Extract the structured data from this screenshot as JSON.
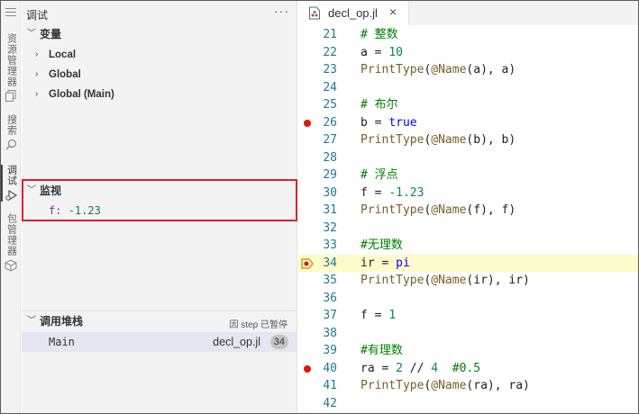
{
  "activity_bar": {
    "explorer_label": "资源管理器",
    "search_label": "搜索",
    "debug_label": "调试",
    "packages_label": "包管理器"
  },
  "sidebar": {
    "title": "调试",
    "more": "···",
    "variables": {
      "header": "变量",
      "scopes": [
        "Local",
        "Global",
        "Global (Main)"
      ]
    },
    "watch": {
      "header": "监视",
      "expression_name": "f",
      "expression_value": "-1.23"
    },
    "call_stack": {
      "header": "调用堆栈",
      "status": "因 step 已暂停",
      "frame": {
        "function": "Main",
        "file": "decl_op.jl",
        "line": "34"
      }
    }
  },
  "editor": {
    "tab": {
      "label": "decl_op.jl",
      "close": "×",
      "icon": "julia-file-icon"
    },
    "current_line": 34,
    "breakpoint_lines": [
      26,
      34,
      40
    ],
    "lines": [
      {
        "n": "21",
        "text": "# 整数"
      },
      {
        "n": "22",
        "text": "a = 10"
      },
      {
        "n": "23",
        "text": "PrintType(@Name(a), a)"
      },
      {
        "n": "24",
        "text": ""
      },
      {
        "n": "25",
        "text": "# 布尔"
      },
      {
        "n": "26",
        "text": "b = true"
      },
      {
        "n": "27",
        "text": "PrintType(@Name(b), b)"
      },
      {
        "n": "28",
        "text": ""
      },
      {
        "n": "29",
        "text": "# 浮点"
      },
      {
        "n": "30",
        "text": "f = -1.23"
      },
      {
        "n": "31",
        "text": "PrintType(@Name(f), f)"
      },
      {
        "n": "32",
        "text": ""
      },
      {
        "n": "33",
        "text": "#无理数"
      },
      {
        "n": "34",
        "text": "ir = pi"
      },
      {
        "n": "35",
        "text": "PrintType(@Name(ir), ir)"
      },
      {
        "n": "36",
        "text": ""
      },
      {
        "n": "37",
        "text": "f = 1"
      },
      {
        "n": "38",
        "text": ""
      },
      {
        "n": "39",
        "text": "#有理数"
      },
      {
        "n": "40",
        "text": "ra = 2 // 4  #0.5"
      },
      {
        "n": "41",
        "text": "PrintType(@Name(ra), ra)"
      },
      {
        "n": "42",
        "text": ""
      }
    ]
  },
  "colors": {
    "breakpoint": "#e51400",
    "current_line_bg": "#fdfbc9",
    "watch_highlight": "#d9212b",
    "line_number": "#237893"
  }
}
